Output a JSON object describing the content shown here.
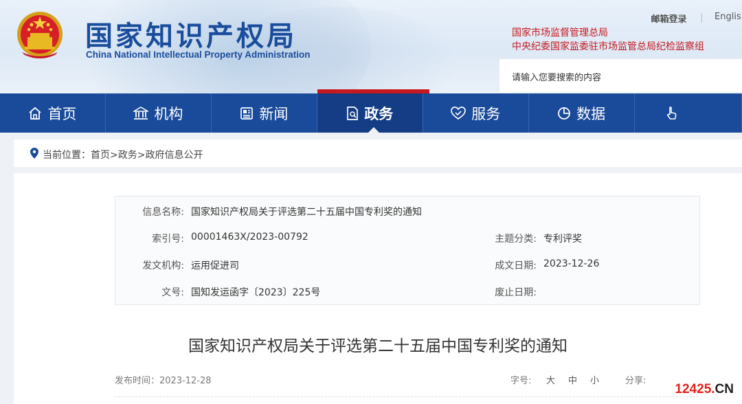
{
  "header": {
    "logo_cn": "国家知识产权局",
    "logo_en": "China National Intellectual Property Administration",
    "top_links": [
      "邮箱登录",
      "English"
    ],
    "red_lines": [
      "国家市场监督管理总局",
      "中央纪委国家监委驻市场监管总局纪检监察组"
    ],
    "search_placeholder": "请输入您要搜索的内容"
  },
  "nav": {
    "items": [
      "首页",
      "机构",
      "新闻",
      "政务",
      "服务",
      "数据",
      ""
    ],
    "active_index": 3,
    "icons": [
      "home-icon",
      "institution-icon",
      "news-icon",
      "government-affairs-icon",
      "service-icon",
      "data-icon",
      "interaction-icon"
    ]
  },
  "breadcrumb": {
    "prefix": "当前位置：",
    "path": "首页>政务>政府信息公开"
  },
  "info": {
    "name_label": "信息名称:",
    "name_value": "国家知识产权局关于评选第二十五届中国专利奖的通知",
    "index_label": "索引号:",
    "index_value": "00001463X/2023-00792",
    "topic_label": "主题分类:",
    "topic_value": "专利评奖",
    "issuer_label": "发文机构:",
    "issuer_value": "运用促进司",
    "date_label": "成文日期:",
    "date_value": "2023-12-26",
    "docno_label": "文号:",
    "docno_value": "国知发运函字〔2023〕225号",
    "repeal_label": "废止日期:",
    "repeal_value": ""
  },
  "article": {
    "title": "国家知识产权局关于评选第二十五届中国专利奖的通知",
    "publish_label": "发布时间：",
    "publish_date": "2023-12-28",
    "font_label": "字号:",
    "font_large": "大",
    "font_medium": "中",
    "font_small": "小",
    "share_label": "分享:"
  },
  "watermark": {
    "num": "12425",
    "dot": ".",
    "cn": "CN"
  },
  "colors": {
    "nav_bg": "#1a4a9a",
    "brand_blue": "#1a4d9c",
    "accent_red": "#c6181d"
  }
}
